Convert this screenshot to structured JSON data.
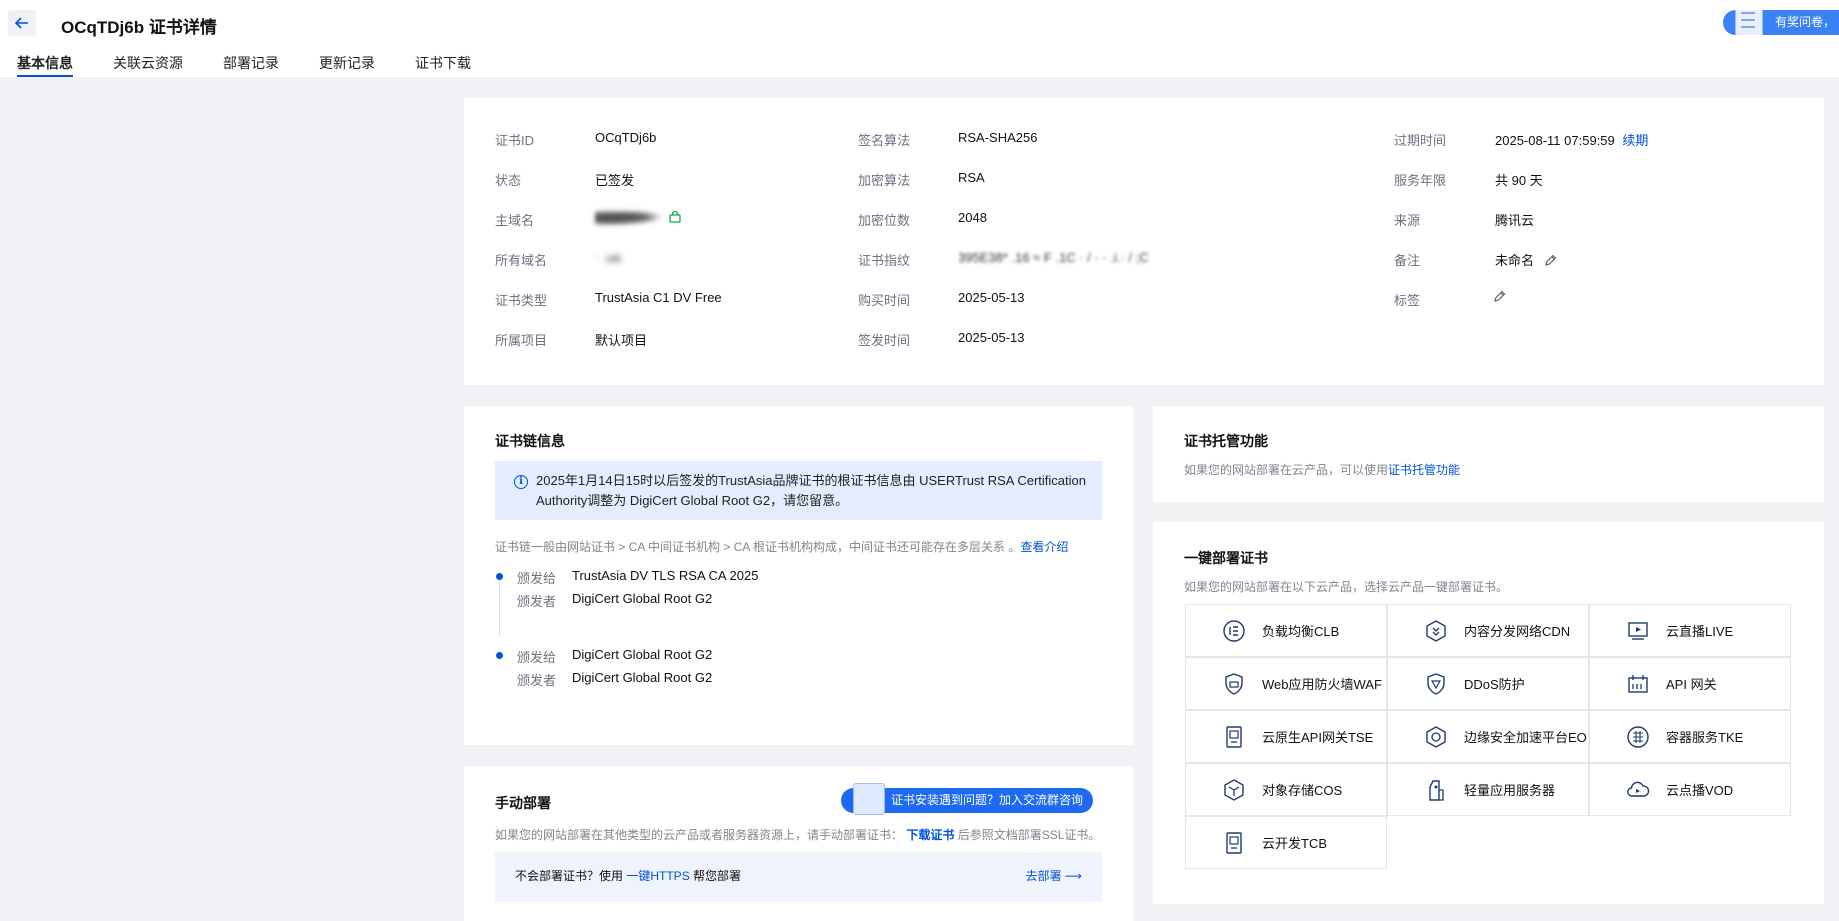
{
  "header": {
    "title": "OCqTDj6b 证书详情",
    "tabs": [
      "基本信息",
      "关联云资源",
      "部署记录",
      "更新记录",
      "证书下载"
    ],
    "survey": "有奖问卷，"
  },
  "info": {
    "cert_id": {
      "label": "证书ID",
      "value": "OCqTDj6b"
    },
    "status": {
      "label": "状态",
      "value": "已签发"
    },
    "main_domain": {
      "label": "主域名"
    },
    "all_domains": {
      "label": "所有域名",
      "value": "·  .ua"
    },
    "cert_type": {
      "label": "证书类型",
      "value": "TrustAsia C1 DV Free"
    },
    "project": {
      "label": "所属项目",
      "value": "默认项目"
    },
    "sign_alg": {
      "label": "签名算法",
      "value": "RSA-SHA256"
    },
    "enc_alg": {
      "label": "加密算法",
      "value": "RSA"
    },
    "key_bits": {
      "label": "加密位数",
      "value": "2048"
    },
    "fingerprint": {
      "label": "证书指纹",
      "value": "395E38* .16 ≈ F .1C   ·  /   ·  ·  .i.· / ;C"
    },
    "purchase_time": {
      "label": "购买时间",
      "value": "2025-05-13"
    },
    "issue_time": {
      "label": "签发时间",
      "value": "2025-05-13"
    },
    "expire": {
      "label": "过期时间",
      "value": "2025-08-11 07:59:59",
      "renew": "续期"
    },
    "service_years": {
      "label": "服务年限",
      "value": "共 90 天"
    },
    "source": {
      "label": "来源",
      "value": "腾讯云"
    },
    "remark": {
      "label": "备注",
      "value": "未命名"
    },
    "tag": {
      "label": "标签"
    }
  },
  "chain": {
    "title": "证书链信息",
    "notice": "2025年1月14日15时以后签发的TrustAsia品牌证书的根证书信息由 USERTrust RSA Certification Authority调整为 DigiCert Global Root G2，请您留意。",
    "desc": "证书链一般由网站证书 > CA 中间证书机构 > CA 根证书机构构成，中间证书还可能存在多层关系 。",
    "desc_link": "查看介绍",
    "issued_to_label": "颁发给",
    "issued_by_label": "颁发者",
    "items": [
      {
        "to": "TrustAsia DV TLS RSA CA 2025",
        "by": "DigiCert Global Root G2"
      },
      {
        "to": "DigiCert Global Root G2",
        "by": "DigiCert Global Root G2"
      }
    ]
  },
  "hosting": {
    "title": "证书托管功能",
    "desc": "如果您的网站部署在云产品，可以使用",
    "link": "证书托管功能"
  },
  "deploy": {
    "title": "一键部署证书",
    "desc": "如果您的网站部署在以下云产品，选择云产品一键部署证书。",
    "products": [
      {
        "name": "负载均衡CLB",
        "icon": "clb-icon"
      },
      {
        "name": "内容分发网络CDN",
        "icon": "cdn-icon"
      },
      {
        "name": "云直播LIVE",
        "icon": "live-icon"
      },
      {
        "name": "Web应用防火墙WAF",
        "icon": "waf-icon"
      },
      {
        "name": "DDoS防护",
        "icon": "ddos-icon"
      },
      {
        "name": "API 网关",
        "icon": "api-gateway-icon"
      },
      {
        "name": "云原生API网关TSE",
        "icon": "tse-icon"
      },
      {
        "name": "边缘安全加速平台EO",
        "icon": "edgeone-icon"
      },
      {
        "name": "容器服务TKE",
        "icon": "tke-icon"
      },
      {
        "name": "对象存储COS",
        "icon": "cos-icon"
      },
      {
        "name": "轻量应用服务器",
        "icon": "lighthouse-icon"
      },
      {
        "name": "云点播VOD",
        "icon": "vod-icon"
      },
      {
        "name": "云开发TCB",
        "icon": "tcb-icon"
      }
    ]
  },
  "manual": {
    "title": "手动部署",
    "join_button": "证书安装遇到问题？加入交流群咨询",
    "desc_before": "如果您的网站部署在其他类型的云产品或者服务器资源上，请手动部署证书：",
    "desc_link": "下载证书",
    "desc_after": "后参照文档部署SSL证书。",
    "banner_before": "不会部署证书？使用",
    "banner_link": "一键HTTPS",
    "banner_after": "帮您部署",
    "banner_go": "去部署 ⟶"
  },
  "colors": {
    "accent": "#0052d9",
    "background": "#f1f2f5"
  }
}
